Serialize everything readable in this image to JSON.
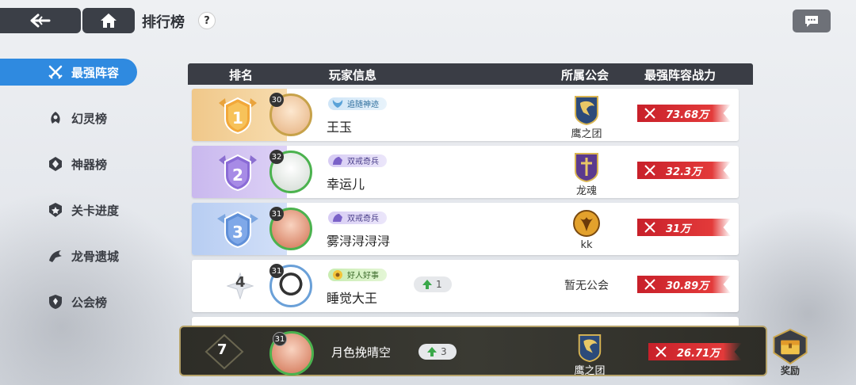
{
  "header": {
    "title": "排行榜",
    "help": "?"
  },
  "sidebar": {
    "items": [
      {
        "label": "最强阵容",
        "active": true,
        "icon": "crossed-swords-icon"
      },
      {
        "label": "幻灵榜",
        "icon": "spirit-icon"
      },
      {
        "label": "神器榜",
        "icon": "artifact-icon"
      },
      {
        "label": "关卡进度",
        "icon": "stage-icon"
      },
      {
        "label": "龙骨遗城",
        "icon": "dragon-icon"
      },
      {
        "label": "公会榜",
        "icon": "guild-shield-icon"
      }
    ]
  },
  "table": {
    "columns": {
      "rank": "排名",
      "player": "玩家信息",
      "guild": "所属公会",
      "power": "最强阵容战力"
    },
    "rows": [
      {
        "rank": "1",
        "level": "30",
        "title": "追随神迹",
        "name": "王玉",
        "guild": "鹰之团",
        "power": "73.68万"
      },
      {
        "rank": "2",
        "level": "32",
        "title": "双戒奇兵",
        "name": "幸运儿",
        "guild": "龙魂",
        "power": "32.3万"
      },
      {
        "rank": "3",
        "level": "31",
        "title": "双戒奇兵",
        "name": "雾浔浔浔浔",
        "guild": "kk",
        "power": "31万"
      },
      {
        "rank": "4",
        "level": "31",
        "title": "好人好事",
        "name": "睡觉大王",
        "change": "1",
        "guild": "暂无公会",
        "power": "30.89万"
      }
    ]
  },
  "my_rank": {
    "rank": "7",
    "level": "31",
    "name": "月色挽晴空",
    "change": "3",
    "guild": "鹰之团",
    "power": "26.71万"
  },
  "reward": {
    "label": "奖励"
  },
  "colors": {
    "accent": "#2f8ae0",
    "power_red": "#d42a30",
    "header_dark": "#3a3d45"
  }
}
